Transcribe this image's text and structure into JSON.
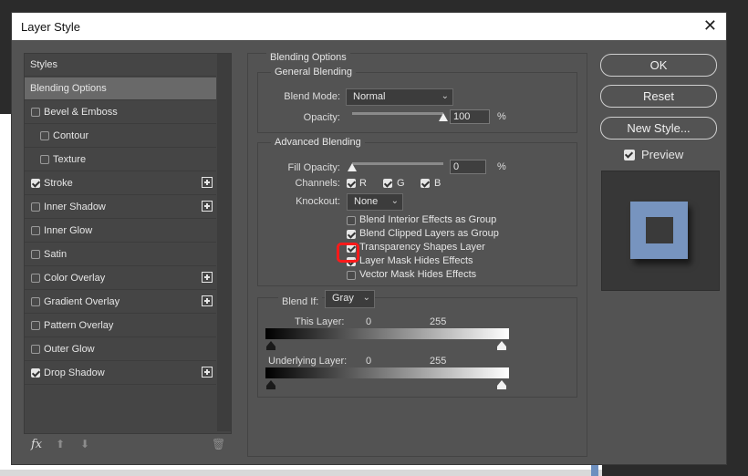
{
  "dialog": {
    "title": "Layer Style"
  },
  "left_panel": {
    "items": [
      {
        "label": "Styles",
        "checkbox": false,
        "checked": false,
        "plus": false,
        "active": false
      },
      {
        "label": "Blending Options",
        "checkbox": false,
        "checked": false,
        "plus": false,
        "active": true
      },
      {
        "label": "Bevel & Emboss",
        "checkbox": true,
        "checked": false,
        "plus": false,
        "active": false
      },
      {
        "label": "Contour",
        "checkbox": true,
        "checked": false,
        "plus": false,
        "active": false,
        "indent": true
      },
      {
        "label": "Texture",
        "checkbox": true,
        "checked": false,
        "plus": false,
        "active": false,
        "indent": true
      },
      {
        "label": "Stroke",
        "checkbox": true,
        "checked": true,
        "plus": true,
        "active": false
      },
      {
        "label": "Inner Shadow",
        "checkbox": true,
        "checked": false,
        "plus": true,
        "active": false
      },
      {
        "label": "Inner Glow",
        "checkbox": true,
        "checked": false,
        "plus": false,
        "active": false
      },
      {
        "label": "Satin",
        "checkbox": true,
        "checked": false,
        "plus": false,
        "active": false
      },
      {
        "label": "Color Overlay",
        "checkbox": true,
        "checked": false,
        "plus": true,
        "active": false
      },
      {
        "label": "Gradient Overlay",
        "checkbox": true,
        "checked": false,
        "plus": true,
        "active": false
      },
      {
        "label": "Pattern Overlay",
        "checkbox": true,
        "checked": false,
        "plus": false,
        "active": false
      },
      {
        "label": "Outer Glow",
        "checkbox": true,
        "checked": false,
        "plus": false,
        "active": false
      },
      {
        "label": "Drop Shadow",
        "checkbox": true,
        "checked": true,
        "plus": true,
        "active": false
      }
    ],
    "footer": {
      "fx": "fx",
      "up": "⬆",
      "down": "⬇",
      "trash": "🗑"
    }
  },
  "blending": {
    "section_title": "Blending Options",
    "general": {
      "legend": "General Blending",
      "blend_mode_label": "Blend Mode:",
      "blend_mode_value": "Normal",
      "opacity_label": "Opacity:",
      "opacity_value": "100",
      "opacity_unit": "%",
      "opacity_level": 1.0
    },
    "advanced": {
      "legend": "Advanced Blending",
      "fill_opacity_label": "Fill Opacity:",
      "fill_opacity_value": "0",
      "fill_opacity_unit": "%",
      "fill_opacity_level": 0.0,
      "channels_label": "Channels:",
      "channels": [
        {
          "label": "R",
          "checked": true
        },
        {
          "label": "G",
          "checked": true
        },
        {
          "label": "B",
          "checked": true
        }
      ],
      "knockout_label": "Knockout:",
      "knockout_value": "None",
      "options": [
        {
          "label": "Blend Interior Effects as Group",
          "checked": false
        },
        {
          "label": "Blend Clipped Layers as Group",
          "checked": true
        },
        {
          "label": "Transparency Shapes Layer",
          "checked": true
        },
        {
          "label": "Layer Mask Hides Effects",
          "checked": true
        },
        {
          "label": "Vector Mask Hides Effects",
          "checked": false
        }
      ]
    },
    "blend_if": {
      "label": "Blend If:",
      "value": "Gray",
      "this_layer_label": "This Layer:",
      "this_layer_low": "0",
      "this_layer_high": "255",
      "underlying_label": "Underlying Layer:",
      "underlying_low": "0",
      "underlying_high": "255"
    }
  },
  "buttons": {
    "ok": "OK",
    "reset": "Reset",
    "new_style": "New Style..."
  },
  "preview": {
    "label": "Preview",
    "checked": true
  }
}
